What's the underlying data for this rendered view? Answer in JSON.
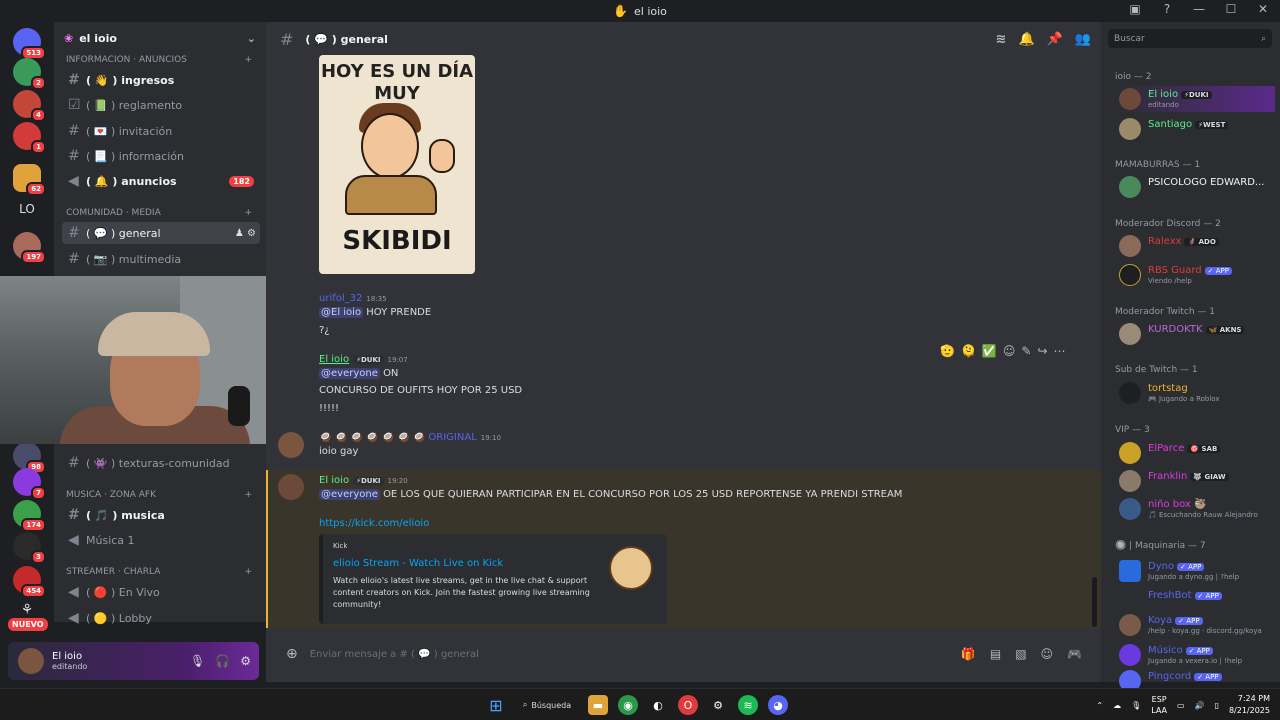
{
  "window": {
    "title": "el ioio"
  },
  "server_rail": {
    "badges": [
      "513",
      "2",
      "4",
      "1",
      "62",
      "197",
      "98",
      "7",
      "174",
      "3",
      "454"
    ],
    "lo_label": "LO",
    "nuevo_label": "NUEVO"
  },
  "sidebar": {
    "server_name": "el ioio",
    "categories": {
      "info": "INFORMACION · ANUNCIOS",
      "comunidad": "COMUNIDAD · MEDIA",
      "musica": "MUSICA · ZONA AFK",
      "streamer": "STREAMER · CHARLA"
    },
    "channels": {
      "ingresos": "( 👋 ) ingresos",
      "reglamento": "( 📗 ) reglamento",
      "invitacion": "( 💌 ) invitación",
      "informacion": "( 📃 ) información",
      "anuncios": "( 🔔 ) anuncios",
      "anuncios_badge": "182",
      "general": "( 💬 ) general",
      "multimedia": "( 📷 ) multimedia",
      "texturas": "( 👾 ) texturas-comunidad",
      "musica": "( 🎵 ) musica",
      "musica1": "Música 1",
      "envivo": "( 🔴 ) En Vivo",
      "lobby": "( 🟡 ) Lobby"
    }
  },
  "user_panel": {
    "name": "El ioio",
    "status": "editando"
  },
  "chat": {
    "channel": "( 💬 ) general",
    "meme": {
      "top": "HOY ES UN DÍA MUY",
      "bottom": "SKIBIDI"
    },
    "messages": {
      "m1_user": "urifol_32",
      "m1_time": "18:35",
      "m1_mention": "@El ioio",
      "m1_text": "HOY PRENDE",
      "m1_line2": "?¿",
      "m2_user": "El ioio",
      "m2_tag": "⚡DUKI",
      "m2_time": "19:07",
      "m2_mention": "@everyone",
      "m2_text": "ON",
      "m2_line2": "CONCURSO DE OUFITS HOY POR 25 USD",
      "m2_line3": "!!!!!",
      "m3_user": "🥥 🥥 🥥 🥥 🥥 🥥 🥥 ORIGINAL",
      "m3_time": "19:10",
      "m3_text": "ioio gay",
      "m4_user": "El ioio",
      "m4_tag": "⚡DUKI",
      "m4_time": "19:20",
      "m4_mention": "@everyone",
      "m4_text": "OE LOS QUE QUIERAN PARTICIPAR EN EL CONCURSO POR LOS 25 USD REPORTENSE YA PRENDI STREAM",
      "m4_link": "https://kick.com/elioio"
    },
    "embed": {
      "provider": "Kick",
      "title": "elioio Stream - Watch Live on Kick",
      "description": "Watch elioio's latest live streams, get in the live chat & support content creators on Kick. Join the fastest growing live streaming community!"
    },
    "composer_placeholder": "Enviar mensaje a # ( 💬 ) general"
  },
  "members": {
    "search_placeholder": "Buscar",
    "groups": {
      "ioio": "ioio — 2",
      "mamaburras": "MAMABURRAS — 1",
      "modDiscord": "Moderador Discord — 2",
      "modTwitch": "Moderador Twitch — 1",
      "subTwitch": "Sub de Twitch — 1",
      "vip": "VIP — 3",
      "maquinaria": "🔘 | Maquinaria — 7"
    },
    "list": {
      "elioio": "El ioio",
      "elioio_tag": "⚡DUKI",
      "elioio_status": "editando",
      "santiago": "Santiago",
      "santiago_tag": "⚡WEST",
      "psicologo": "PSICOLOGO EDWARD...",
      "ralexx": "Ralexx",
      "ralexx_tag": "🦸 ADO",
      "rbs": "RBS Guard",
      "rbs_tag": "✓ APP",
      "rbs_status": "Viendo /help",
      "kurdoktk": "KURDOKTK",
      "kurdoktk_tag": "🦋 AKNS",
      "tortstag": "tortstag",
      "tortstag_status": "🎮 Jugando a Roblox",
      "elparce": "ElParce",
      "elparce_tag": "🎯 SAB",
      "franklin": "Franklin",
      "franklin_tag": "🐺 GIAW",
      "ninobox": "niño box 🦥",
      "ninobox_status": "🎵 Escuchando Rauw Alejandro",
      "dyno": "Dyno",
      "dyno_tag": "✓ APP",
      "dyno_status": "Jugando a dyno.gg | ?help",
      "freshbot": "FreshBot",
      "freshbot_tag": "✓ APP",
      "koya": "Koya",
      "koya_tag": "✓ APP",
      "koya_status": "/help · koya.gg · discord.gg/koya",
      "musico": "Músico",
      "musico_tag": "✓ APP",
      "musico_status": "Jugando a vexera.io | !help",
      "pingcord": "Pingcord",
      "pingcord_tag": "✓ APP"
    }
  },
  "taskbar": {
    "search": "Búsqueda",
    "lang1": "ESP",
    "lang2": "LAA",
    "time": "7:24 PM",
    "date": "8/21/2025"
  }
}
